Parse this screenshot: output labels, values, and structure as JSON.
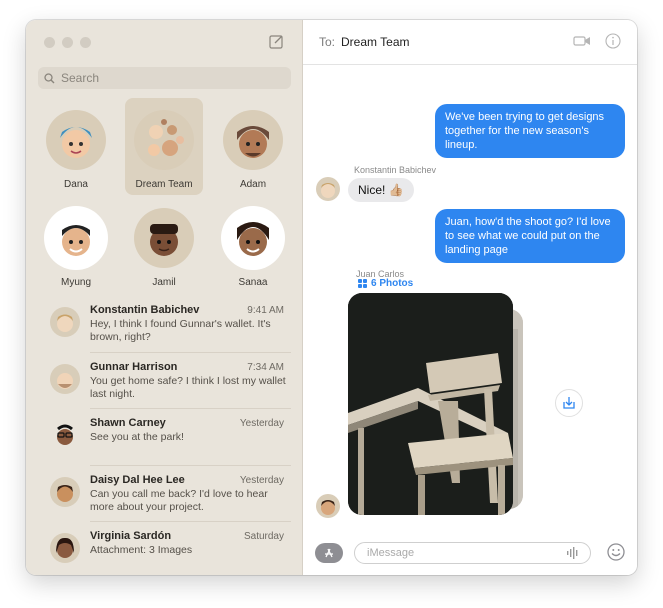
{
  "sidebar": {
    "search_placeholder": "Search",
    "pinned": [
      {
        "name": "Dana"
      },
      {
        "name": "Dream Team"
      },
      {
        "name": "Adam"
      },
      {
        "name": "Myung"
      },
      {
        "name": "Jamil"
      },
      {
        "name": "Sanaa"
      }
    ],
    "conversations": [
      {
        "name": "Konstantin Babichev",
        "time": "9:41 AM",
        "preview": "Hey, I think I found Gunnar's wallet. It's brown, right?"
      },
      {
        "name": "Gunnar Harrison",
        "time": "7:34 AM",
        "preview": "You get home safe? I think I lost my wallet last night."
      },
      {
        "name": "Shawn Carney",
        "time": "Yesterday",
        "preview": "See you at the park!"
      },
      {
        "name": "Daisy Dal Hee Lee",
        "time": "Yesterday",
        "preview": "Can you call me back? I'd love to hear more about your project."
      },
      {
        "name": "Virginia Sardón",
        "time": "Saturday",
        "preview": "Attachment: 3 Images"
      }
    ]
  },
  "header": {
    "to_label": "To:",
    "to_name": "Dream Team"
  },
  "messages": {
    "out1": "We've been trying to get designs together for the new season's lineup.",
    "sender1": "Konstantin Babichev",
    "in1": "Nice! 👍🏼",
    "out2": "Juan, how'd the shoot go? I'd love to see what we could put on the landing page",
    "sender2": "Juan Carlos",
    "photos_label": "6 Photos"
  },
  "composer": {
    "placeholder": "iMessage"
  },
  "colors": {
    "sidebar_bg": "#e9e4db",
    "selected_pin": "#dcd2c0",
    "bubble_blue": "#2e86f0"
  }
}
